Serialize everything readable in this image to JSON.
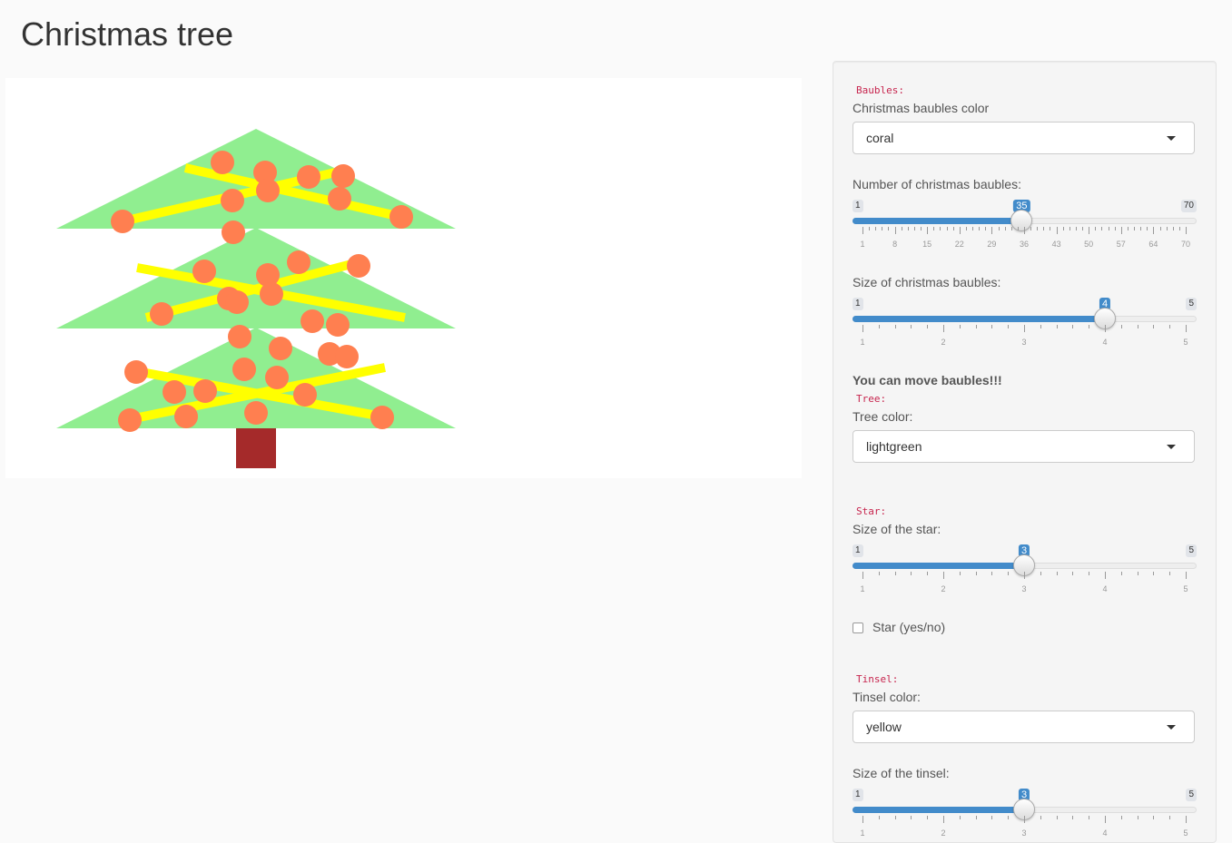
{
  "page": {
    "title": "Christmas tree"
  },
  "colors": {
    "tree": "#90ee90",
    "trunk": "#a52a2a",
    "tinsel": "#ffff00",
    "bauble": "#ff7f50",
    "accent": "#428bca",
    "code": "#c7254e"
  },
  "baubles": {
    "section_label": "Baubles:",
    "color_label": "Christmas baubles color",
    "color_value": "coral",
    "count": {
      "label": "Number of christmas baubles:",
      "min": 1,
      "max": 70,
      "value": 35,
      "min_label": "1",
      "max_label": "70",
      "value_label": "35",
      "tick_labels": [
        "1",
        "8",
        "15",
        "22",
        "29",
        "36",
        "43",
        "50",
        "57",
        "64",
        "70"
      ]
    },
    "size": {
      "label": "Size of christmas baubles:",
      "min": 1,
      "max": 5,
      "value": 4,
      "min_label": "1",
      "max_label": "5",
      "value_label": "4",
      "tick_labels": [
        "1",
        "2",
        "3",
        "4",
        "5"
      ]
    },
    "move_note": "You can move baubles!!!"
  },
  "tree": {
    "section_label": "Tree:",
    "color_label": "Tree color:",
    "color_value": "lightgreen"
  },
  "star": {
    "section_label": "Star:",
    "size": {
      "label": "Size of the star:",
      "min": 1,
      "max": 5,
      "value": 3,
      "min_label": "1",
      "max_label": "5",
      "value_label": "3",
      "tick_labels": [
        "1",
        "2",
        "3",
        "4",
        "5"
      ]
    },
    "toggle_label": "Star (yes/no)",
    "toggle_checked": false
  },
  "tinsel": {
    "section_label": "Tinsel:",
    "color_label": "Tinsel color:",
    "color_value": "yellow",
    "size": {
      "label": "Size of the tinsel:",
      "min": 1,
      "max": 5,
      "value": 3,
      "min_label": "1",
      "max_label": "5",
      "value_label": "3",
      "tick_labels": [
        "1",
        "2",
        "3",
        "4",
        "5"
      ]
    }
  }
}
